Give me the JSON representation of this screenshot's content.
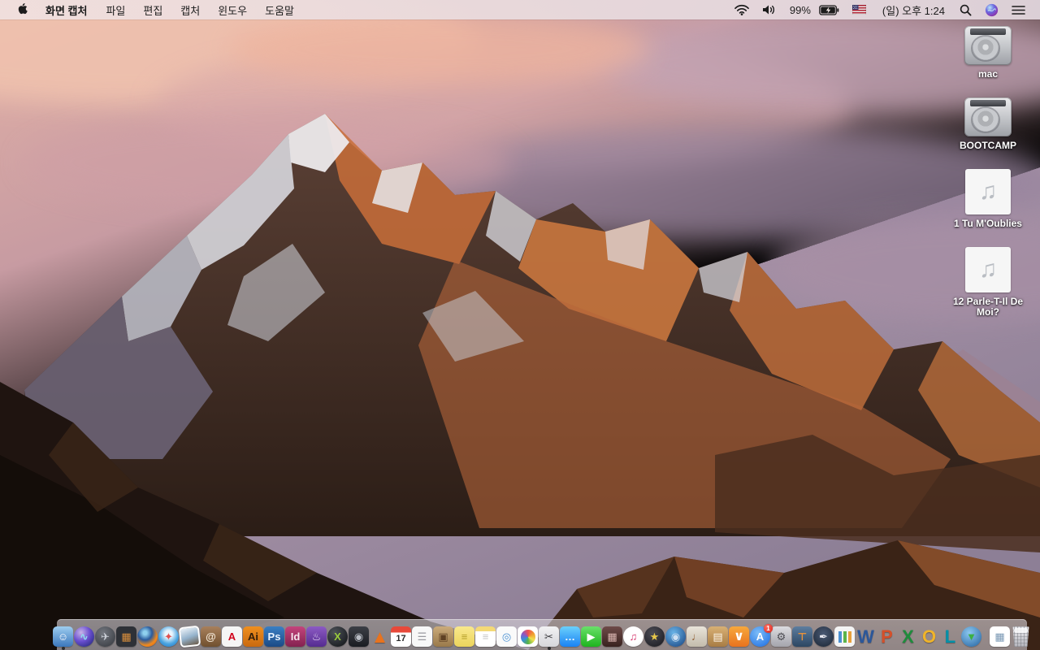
{
  "menu_bar": {
    "apple_icon": "apple-logo",
    "app_name": "화면 캡처",
    "menus": [
      "파일",
      "편집",
      "캡처",
      "윈도우",
      "도움말"
    ],
    "status": {
      "battery_percent": "99%",
      "clock": "(일) 오후 1:24",
      "icon_names": [
        "wifi-icon",
        "volume-icon",
        "battery-charging-icon",
        "us-flag-input-icon",
        "spotlight-search-icon",
        "siri-icon",
        "notification-center-icon"
      ]
    }
  },
  "desktop": {
    "icons": [
      {
        "name": "volume-mac",
        "label": "mac",
        "type": "hard-drive",
        "glyph": ""
      },
      {
        "name": "volume-bootcamp",
        "label": "BOOTCAMP",
        "type": "hard-drive",
        "glyph": ""
      },
      {
        "name": "audio-file-1-tu-moublies",
        "label": "1 Tu M'Oublies",
        "type": "audio-file",
        "glyph": "♫"
      },
      {
        "name": "audio-file-12-parle-t-il-de-moi",
        "label": "12 Parle-T-Il De Moi?",
        "type": "audio-file",
        "glyph": "♫"
      }
    ]
  },
  "dock": {
    "items": [
      {
        "name": "finder",
        "shape": "rounded",
        "bg": "linear-gradient(180deg,#9ecdf0 0%,#3b77bc 100%)",
        "glyph": "☺",
        "fg": "#ffffff",
        "running": true
      },
      {
        "name": "siri",
        "shape": "circle",
        "bg": "radial-gradient(circle at 35% 30%, #c8b4e8, #6a4fd0 45%, #16226a)",
        "glyph": "∿",
        "fg": "#8fe0f0"
      },
      {
        "name": "launchpad",
        "shape": "circle",
        "bg": "radial-gradient(circle at 40% 32%, #73777f, #33363c)",
        "glyph": "✈",
        "fg": "#caced6"
      },
      {
        "name": "mission-control",
        "shape": "rounded",
        "bg": "#2e3137",
        "glyph": "▦",
        "fg": "#d98e3c"
      },
      {
        "name": "firefox",
        "shape": "circle",
        "bg": "radial-gradient(circle at 38% 32%, #8fd0ee 10%, #2a5a9c 38%, #ef8a1e 66%, #d4550a)",
        "glyph": "",
        "fg": "#fff"
      },
      {
        "name": "safari",
        "shape": "circle",
        "bg": "radial-gradient(circle at 50% 38%, #eaf5fd 22%, #4aa4e0 60%, #1a6fc4)",
        "glyph": "✦",
        "fg": "#e05050"
      },
      {
        "name": "image-viewer",
        "shape": "rounded",
        "cls": "d-photo",
        "bg": "linear-gradient(165deg,#dfe9f2 8%,#94b2cc 52%,#6b5a48 100%)",
        "glyph": "",
        "fg": "#fff"
      },
      {
        "name": "contacts",
        "shape": "rounded",
        "bg": "linear-gradient(180deg,#ab825e 0%,#a8805c 0%,#70502f 100%)",
        "glyph": "@",
        "fg": "#f2e6d4"
      },
      {
        "name": "acrobat-reader",
        "shape": "rounded",
        "bg": "#f5f5f5",
        "glyph": "A",
        "fg": "#d0021b"
      },
      {
        "name": "illustrator",
        "shape": "rounded",
        "bg": "linear-gradient(180deg,#ef8f1e,#c96a10)",
        "glyph": "Ai",
        "fg": "#301d08"
      },
      {
        "name": "photoshop",
        "shape": "rounded",
        "bg": "linear-gradient(180deg,#3a7fc4,#1c4a85)",
        "glyph": "Ps",
        "fg": "#e8f3ff"
      },
      {
        "name": "indesign",
        "shape": "rounded",
        "bg": "linear-gradient(180deg,#c4447c,#832250)",
        "glyph": "Id",
        "fg": "#f8e6ef"
      },
      {
        "name": "toast-titanium",
        "shape": "rounded",
        "bg": "linear-gradient(180deg,#8c5ac4,#552c90)",
        "glyph": "♨",
        "fg": "#e9d9f9"
      },
      {
        "name": "x-converter-app",
        "shape": "circle",
        "bg": "radial-gradient(circle at 35% 30%, #4c5158, #0f1114)",
        "glyph": "X",
        "fg": "#9acc3c"
      },
      {
        "name": "disk-utility-app",
        "shape": "rounded",
        "bg": "linear-gradient(180deg,#3c3f46,#1a1c22)",
        "glyph": "◉",
        "fg": "#b9bdc5"
      },
      {
        "name": "vlc",
        "shape": "plain",
        "bg": "",
        "glyph": "▲",
        "fg": "#e8731e",
        "big": true
      },
      {
        "name": "calendar",
        "shape": "rounded",
        "cls": "d-cal",
        "bg": "linear-gradient(180deg,#e8493a 0%,#e8493a 30%,#ffffff 30%)",
        "glyph": "17",
        "fg": "#2b2b2b"
      },
      {
        "name": "reminders",
        "shape": "rounded",
        "bg": "#f8f8f8",
        "glyph": "☰",
        "fg": "#9a9aa0"
      },
      {
        "name": "stuffit-expander",
        "shape": "rounded",
        "bg": "linear-gradient(180deg,#cbab7b,#99794a)",
        "glyph": "▣",
        "fg": "#5f4124"
      },
      {
        "name": "stickies",
        "shape": "rounded",
        "bg": "linear-gradient(180deg,#f8e88c,#ecd45c)",
        "glyph": "≡",
        "fg": "#b5a02c"
      },
      {
        "name": "notes",
        "shape": "rounded",
        "bg": "linear-gradient(180deg,#f4d976 0%,#f4d976 24%,#ffffff 24%)",
        "glyph": "≡",
        "fg": "#c6c6c6"
      },
      {
        "name": "preview",
        "shape": "rounded",
        "bg": "#fafafa",
        "glyph": "◎",
        "fg": "#4a90d2"
      },
      {
        "name": "photos",
        "shape": "rounded",
        "cls": "d-photos",
        "bg": "#ffffff",
        "glyph": "",
        "fg": "#fff"
      },
      {
        "name": "grab-screen-capture",
        "shape": "rounded",
        "bg": "linear-gradient(180deg,#f2f2f4,#d6d6da)",
        "glyph": "✂",
        "fg": "#3c3c40",
        "running": true
      },
      {
        "name": "messages",
        "shape": "rounded",
        "bg": "linear-gradient(180deg,#6ad0fc,#1a82f4)",
        "glyph": "…",
        "fg": "#ffffff"
      },
      {
        "name": "facetime",
        "shape": "rounded",
        "bg": "linear-gradient(180deg,#6ae06a,#1eb41e)",
        "glyph": "▶",
        "fg": "#ffffff"
      },
      {
        "name": "photo-booth",
        "shape": "rounded",
        "bg": "linear-gradient(180deg,#6e4a48,#38221f)",
        "glyph": "▦",
        "fg": "#dbb6b2"
      },
      {
        "name": "itunes",
        "shape": "circle",
        "bg": "radial-gradient(circle at 50% 40%, #ffffff 55%, #e8e8ec)",
        "glyph": "♫",
        "fg": "#d6386e"
      },
      {
        "name": "imovie",
        "shape": "circle",
        "bg": "radial-gradient(circle at 40% 32%, #4c4c55, #17171d)",
        "glyph": "★",
        "fg": "#e8c84a"
      },
      {
        "name": "dvd-player",
        "shape": "circle",
        "bg": "radial-gradient(circle at 40% 32%, #6ab4e8, #17427f)",
        "glyph": "◉",
        "fg": "#cfe0f2"
      },
      {
        "name": "garageband",
        "shape": "rounded",
        "bg": "linear-gradient(180deg,#e9e4da,#c3bbac)",
        "glyph": "♩",
        "fg": "#8c5a2c"
      },
      {
        "name": "comic-life",
        "shape": "rounded",
        "bg": "linear-gradient(180deg,#d8b074,#a87c44)",
        "glyph": "▤",
        "fg": "#fdf6ea"
      },
      {
        "name": "ibooks",
        "shape": "rounded",
        "cls": "d-book",
        "bg": "linear-gradient(180deg,#f8a83c,#e8731e)",
        "glyph": "∨",
        "fg": "#ffffff"
      },
      {
        "name": "app-store",
        "shape": "circle",
        "bg": "radial-gradient(circle at 40% 32%, #7cbdf8, #1a6ae0)",
        "glyph": "A",
        "fg": "#ffffff",
        "badge": "1"
      },
      {
        "name": "system-preferences",
        "shape": "rounded",
        "bg": "linear-gradient(180deg,#dcdce0,#a4a4ac)",
        "glyph": "⚙",
        "fg": "#4e4e54"
      },
      {
        "name": "keynote",
        "shape": "rounded",
        "bg": "linear-gradient(180deg,#5d7d9f,#2c4662)",
        "glyph": "⊤",
        "fg": "#e8923a"
      },
      {
        "name": "pages",
        "shape": "circle",
        "bg": "radial-gradient(circle at 50% 38%, #4a5a74, #1a2534)",
        "glyph": "✒",
        "fg": "#e9e9f1"
      },
      {
        "name": "numbers",
        "shape": "rounded",
        "cls": "d-bars",
        "bg": "#f4f4f4",
        "glyph": "",
        "fg": "#fff"
      },
      {
        "name": "word",
        "shape": "plain",
        "bg": "",
        "glyph": "W",
        "fg": "#2b579a",
        "big": true
      },
      {
        "name": "powerpoint",
        "shape": "plain",
        "bg": "",
        "glyph": "P",
        "fg": "#d4502a",
        "big": true
      },
      {
        "name": "excel",
        "shape": "plain",
        "bg": "",
        "glyph": "X",
        "fg": "#1e8c3c",
        "big": true
      },
      {
        "name": "outlook",
        "shape": "plain",
        "bg": "",
        "glyph": "O",
        "fg": "#f0b429",
        "big": true
      },
      {
        "name": "lync",
        "shape": "plain",
        "bg": "",
        "glyph": "L",
        "fg": "#0090a8",
        "big": true
      },
      {
        "name": "web-downloader",
        "shape": "circle",
        "bg": "radial-gradient(circle at 40% 32%, #8cc8f0, #23619f)",
        "glyph": "▼",
        "fg": "#3cb043"
      },
      {
        "name": "dock-separator",
        "kind": "separator"
      },
      {
        "name": "document-file",
        "shape": "rounded",
        "bg": "#ffffff",
        "glyph": "▦",
        "fg": "#7a98b4"
      },
      {
        "name": "trash",
        "shape": "rounded",
        "cls": "d-trash",
        "bg": "linear-gradient(180deg,#eeeef2,#b4b4bc)",
        "glyph": "",
        "fg": "#fff"
      }
    ]
  }
}
